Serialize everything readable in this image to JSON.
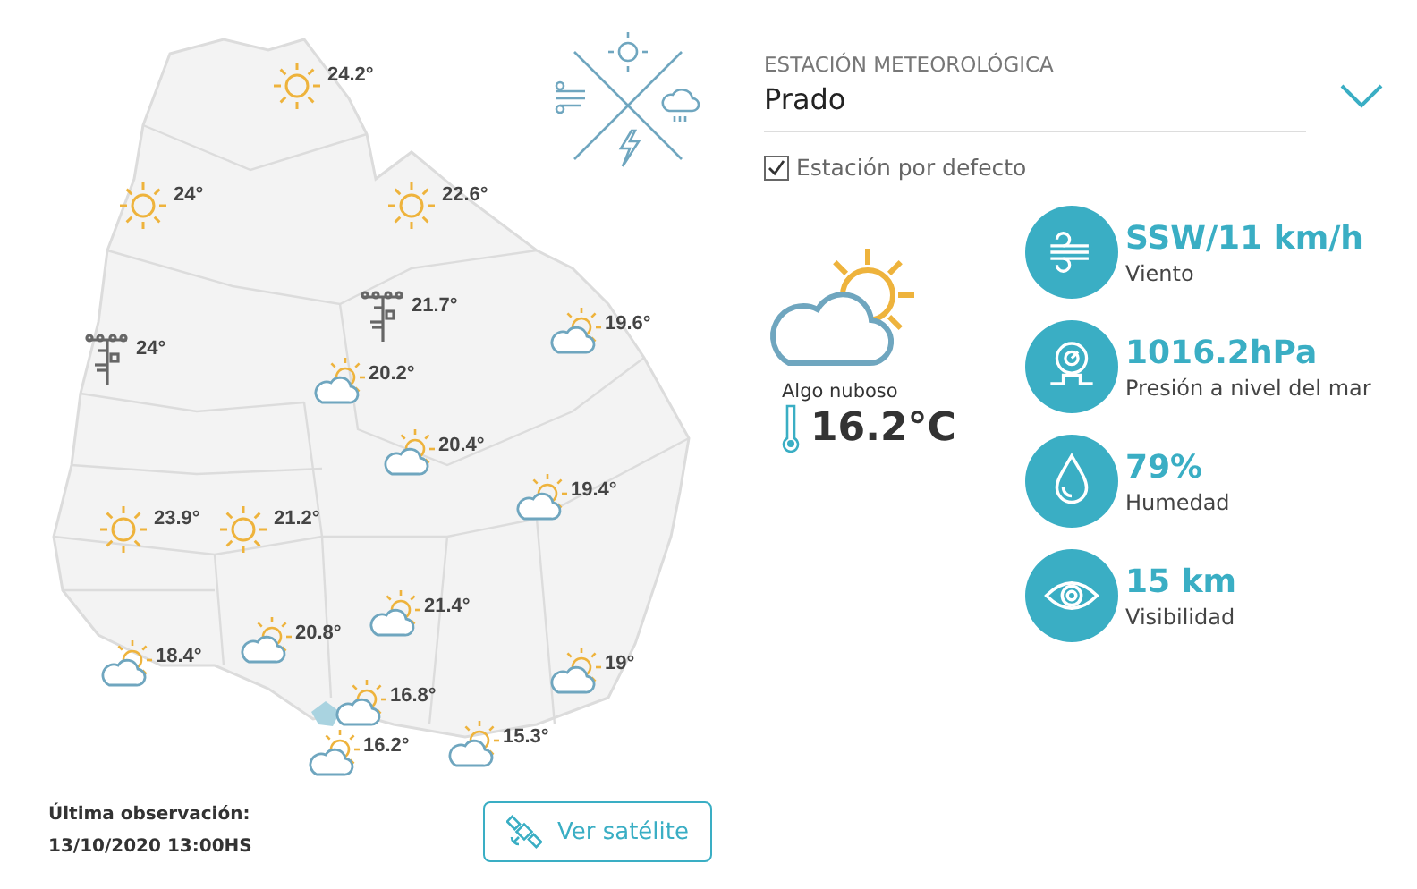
{
  "map": {
    "markers": [
      {
        "kind": "sun",
        "temp": "24.2°"
      },
      {
        "kind": "sun",
        "temp": "24°"
      },
      {
        "kind": "sun",
        "temp": "22.6°"
      },
      {
        "kind": "station",
        "temp": "21.7°"
      },
      {
        "kind": "station",
        "temp": "24°"
      },
      {
        "kind": "partly",
        "temp": "19.6°"
      },
      {
        "kind": "partly",
        "temp": "20.2°"
      },
      {
        "kind": "partly",
        "temp": "20.4°"
      },
      {
        "kind": "partly",
        "temp": "19.4°"
      },
      {
        "kind": "sun",
        "temp": "23.9°"
      },
      {
        "kind": "sun",
        "temp": "21.2°"
      },
      {
        "kind": "partly",
        "temp": "20.8°"
      },
      {
        "kind": "partly",
        "temp": "21.4°"
      },
      {
        "kind": "partly",
        "temp": "18.4°"
      },
      {
        "kind": "partly",
        "temp": "19°"
      },
      {
        "kind": "partly",
        "temp": "16.8°"
      },
      {
        "kind": "partly",
        "temp": "16.2°"
      },
      {
        "kind": "partly",
        "temp": "15.3°"
      }
    ]
  },
  "station": {
    "label": "ESTACIÓN METEOROLÓGICA",
    "value": "Prado",
    "default_checkbox": {
      "label": "Estación por defecto",
      "checked": true
    }
  },
  "current": {
    "condition": "Algo nuboso",
    "temperature": "16.2°C"
  },
  "stats": [
    {
      "kind": "wind",
      "value": "SSW/11 km/h",
      "label": "Viento"
    },
    {
      "kind": "pressure",
      "value": "1016.2hPa",
      "label": "Presión a nivel del mar"
    },
    {
      "kind": "humidity",
      "value": "79%",
      "label": "Humedad"
    },
    {
      "kind": "visibility",
      "value": "15 km",
      "label": "Visibilidad"
    }
  ],
  "footer": {
    "label": "Última observación:",
    "timestamp": "13/10/2020 13:00HS",
    "button": "Ver satélite"
  }
}
